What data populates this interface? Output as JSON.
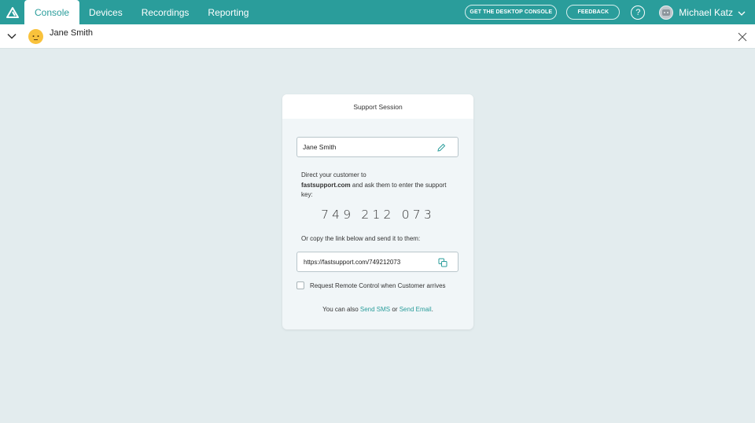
{
  "colors": {
    "brand": "#2a9d9b",
    "background": "#e3ecee"
  },
  "topbar": {
    "logo_icon": "triangle-logo-icon",
    "tabs": [
      {
        "label": "Console",
        "active": true
      },
      {
        "label": "Devices",
        "active": false
      },
      {
        "label": "Recordings",
        "active": false
      },
      {
        "label": "Reporting",
        "active": false
      }
    ],
    "desktop_console_label": "GET THE DESKTOP CONSOLE",
    "feedback_label": "FEEDBACK",
    "help_label": "?",
    "user_name": "Michael Katz"
  },
  "session_bar": {
    "customer_name": "Jane Smith"
  },
  "card": {
    "title": "Support Session",
    "customer_name_value": "Jane Smith",
    "instruction_prefix": "Direct your customer to",
    "instruction_domain": "fastsupport.com",
    "instruction_suffix": " and ask them to enter the support key:",
    "support_key": "749 212 073",
    "copy_instruction": "Or copy the link below and send it to them:",
    "link_value": "https://fastsupport.com/749212073",
    "checkbox_label": "Request Remote Control when Customer arrives",
    "checkbox_checked": false,
    "footer_prefix": "You can also ",
    "send_sms": "Send SMS",
    "footer_or": " or ",
    "send_email": "Send Email",
    "footer_suffix": "."
  }
}
